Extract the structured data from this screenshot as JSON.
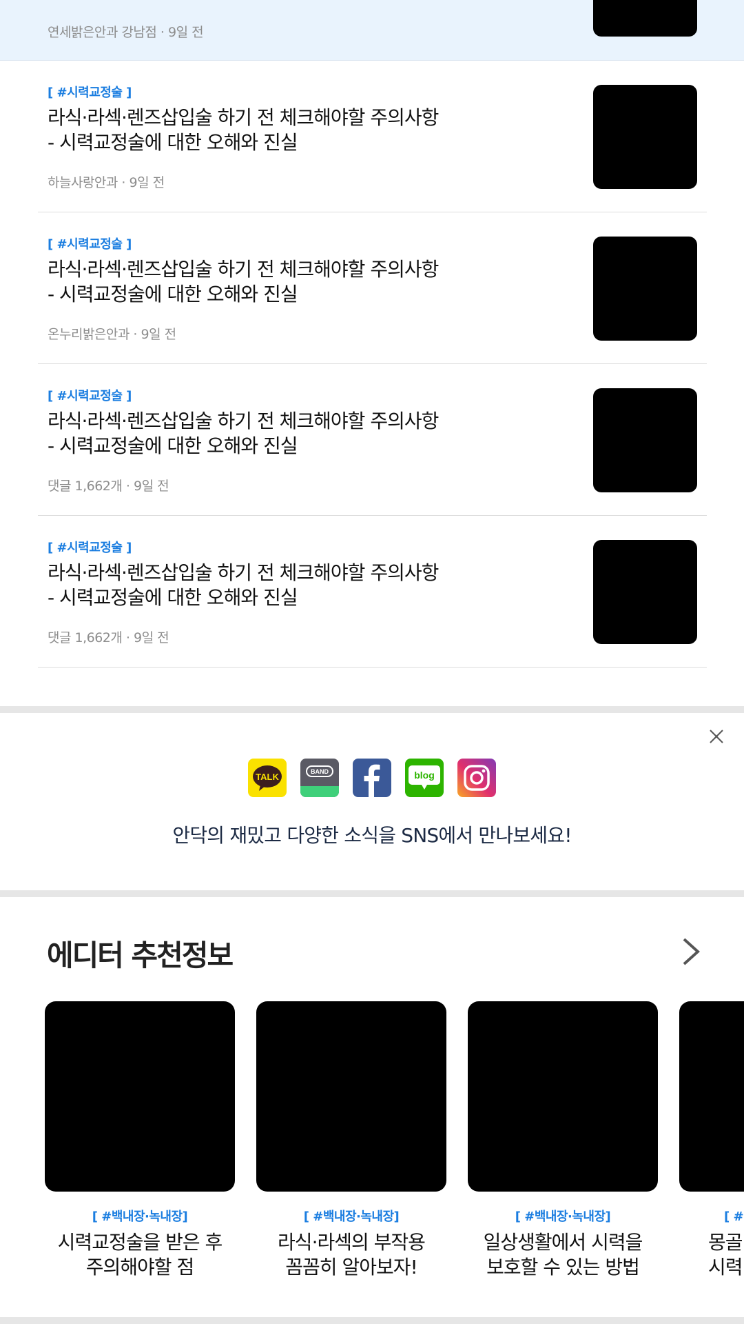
{
  "articles": [
    {
      "tag": "",
      "title": "",
      "meta": "연세밝은안과 강남점 · 9일 전",
      "highlighted": true
    },
    {
      "tag": "[ #시력교정술 ]",
      "title": "라식·라섹·렌즈삽입술 하기 전 체크해야할 주의사항\n- 시력교정술에 대한 오해와 진실",
      "meta": "하늘사랑안과 · 9일 전"
    },
    {
      "tag": "[ #시력교정술 ]",
      "title": "라식·라섹·렌즈삽입술 하기 전 체크해야할 주의사항\n- 시력교정술에 대한 오해와 진실",
      "meta": "온누리밝은안과 · 9일 전"
    },
    {
      "tag": "[ #시력교정술 ]",
      "title": "라식·라섹·렌즈삽입술 하기 전 체크해야할 주의사항\n- 시력교정술에 대한 오해와 진실",
      "meta": "댓글 1,662개 · 9일 전"
    },
    {
      "tag": "[ #시력교정술 ]",
      "title": "라식·라섹·렌즈삽입술 하기 전 체크해야할 주의사항\n- 시력교정술에 대한 오해와 진실",
      "meta": "댓글 1,662개 · 9일 전"
    }
  ],
  "sns": {
    "text": "안닥의 재밌고 다양한 소식을 SNS에서 만나보세요!",
    "icons": [
      {
        "name": "kakaotalk-icon",
        "label": "TALK",
        "color": "#fae100"
      },
      {
        "name": "band-icon",
        "label": "BAND",
        "color": "#5a5a64"
      },
      {
        "name": "facebook-icon",
        "label": "f",
        "color": "#3b5998"
      },
      {
        "name": "blog-icon",
        "label": "blog",
        "color": "#2db400"
      },
      {
        "name": "instagram-icon",
        "label": "",
        "color": "#c13584"
      }
    ]
  },
  "editor": {
    "heading": "에디터 추천정보",
    "cards": [
      {
        "tag": "[ #백내장·녹내장]",
        "title": "시력교정술을 받은 후\n주의해야할 점"
      },
      {
        "tag": "[ #백내장·녹내장]",
        "title": "라식·라섹의 부작용\n꼼꼼히 알아보자!"
      },
      {
        "tag": "[ #백내장·녹내장]",
        "title": "일상생활에서 시력을\n보호할 수 있는 방법"
      },
      {
        "tag": "[ #백",
        "title": "몽골\n시력"
      }
    ]
  },
  "colors": {
    "accent": "#1a7de0",
    "highlight_bg": "#e9f3fd",
    "meta_text": "#8d8d8d"
  }
}
